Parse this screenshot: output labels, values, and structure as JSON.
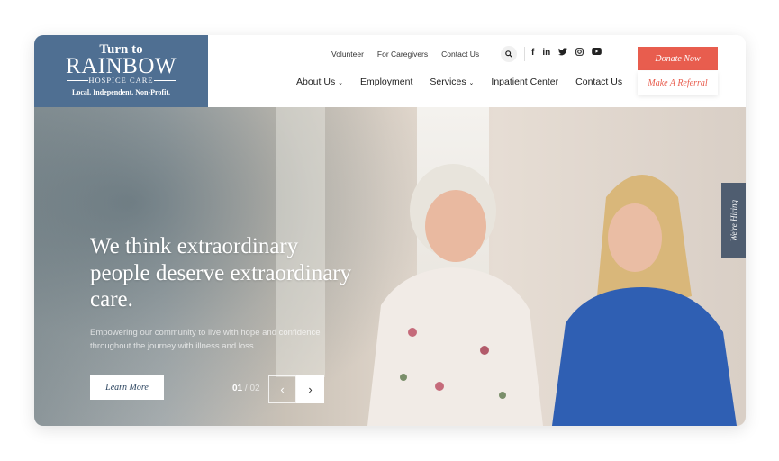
{
  "logo": {
    "line1": "Turn to",
    "line2": "RAINBOW",
    "line3": "HOSPICE CARE",
    "tagline": "Local. Independent. Non-Profit."
  },
  "top_nav": [
    "Volunteer",
    "For Caregivers",
    "Contact Us"
  ],
  "icons": {
    "search": "search-icon",
    "social": [
      "facebook-icon",
      "linkedin-icon",
      "twitter-icon",
      "instagram-icon",
      "youtube-icon"
    ]
  },
  "main_nav": [
    {
      "label": "About Us",
      "dropdown": true
    },
    {
      "label": "Employment",
      "dropdown": false
    },
    {
      "label": "Services",
      "dropdown": true
    },
    {
      "label": "Inpatient Center",
      "dropdown": false
    },
    {
      "label": "Contact Us",
      "dropdown": false
    }
  ],
  "cta": {
    "donate": "Donate Now",
    "referral": "Make A Referral"
  },
  "hero": {
    "headline": "We think extraordinary people deserve extraordinary care.",
    "subtext": "Empowering our community to live with hope and confidence throughout the journey with illness and loss.",
    "button": "Learn More",
    "slide_current": "01",
    "slide_total": "/ 02",
    "prev": "‹",
    "next": "›"
  },
  "side_tab": "We're Hiring",
  "colors": {
    "brand_blue": "#4f6f92",
    "accent_red": "#e85d4e",
    "hiring_tab": "#4f5d70"
  }
}
